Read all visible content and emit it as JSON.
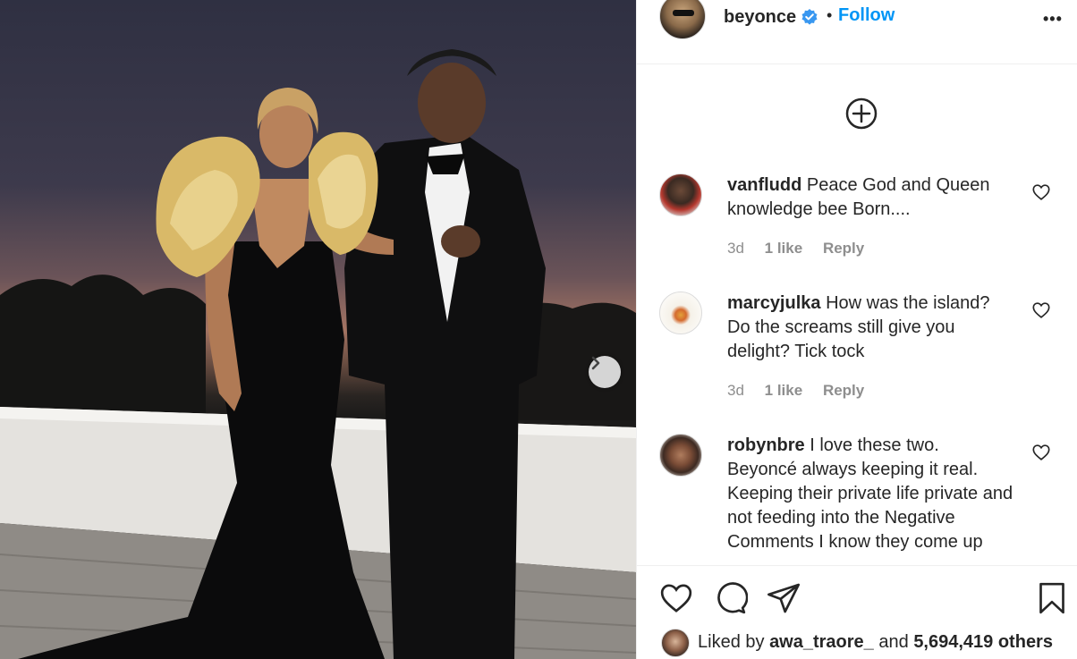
{
  "post": {
    "username": "beyonce",
    "dot": "•",
    "follow_label": "Follow",
    "more_label": "•••",
    "icons": {
      "verified": "verified-badge-icon",
      "load_more": "plus-circle-icon",
      "next": "chevron-right-icon",
      "like": "heart-icon",
      "comment": "comment-bubble-icon",
      "share": "paper-plane-icon",
      "save": "bookmark-icon"
    },
    "accent_color": "#0095f6"
  },
  "comments": [
    {
      "user": "vanfludd",
      "text": "Peace God and Queen knowledge bee Born....",
      "time": "3d",
      "likes": "1 like",
      "reply": "Reply"
    },
    {
      "user": "marcyjulka",
      "text": "How was the island? Do the screams still give you delight? Tick tock",
      "time": "3d",
      "likes": "1 like",
      "reply": "Reply"
    },
    {
      "user": "robynbre",
      "text": "I love these two. Beyoncé always keeping it real. Keeping their private life private and not feeding into the Negative Comments I know they come up"
    }
  ],
  "likes": {
    "prefix": "Liked by",
    "user": "awa_traore_",
    "middle": "and",
    "count": "5,694,419 others"
  }
}
